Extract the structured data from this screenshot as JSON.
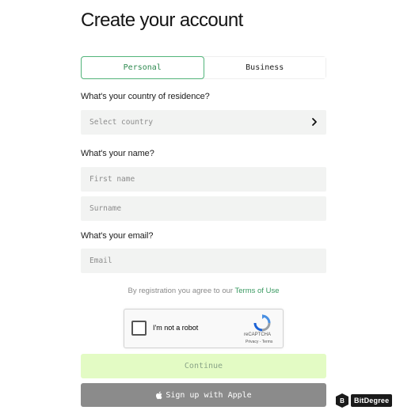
{
  "page": {
    "title": "Create your account"
  },
  "account_type": {
    "personal": "Personal",
    "business": "Business",
    "selected": "Personal"
  },
  "country": {
    "question": "What's your country of residence?",
    "placeholder": "Select country"
  },
  "name": {
    "question": "What's your name?",
    "first_placeholder": "First name",
    "surname_placeholder": "Surname"
  },
  "email": {
    "question": "What's your email?",
    "placeholder": "Email"
  },
  "terms": {
    "prefix": "By registration you agree to our ",
    "link": "Terms of Use"
  },
  "captcha": {
    "label": "I'm not a robot",
    "brand": "reCAPTCHA",
    "links": "Privacy - Terms"
  },
  "buttons": {
    "continue": "Continue",
    "apple": "Sign up with Apple"
  },
  "watermark": {
    "text": "BitDegree"
  },
  "colors": {
    "accent": "#52b47a",
    "continue_bg": "#e3fbc4",
    "apple_bg": "#8b8b8b",
    "field_bg": "#f2f3f2"
  },
  "icons": {
    "chevron": "chevron-right-icon",
    "apple": "apple-icon",
    "recaptcha": "recaptcha-logo-icon"
  }
}
